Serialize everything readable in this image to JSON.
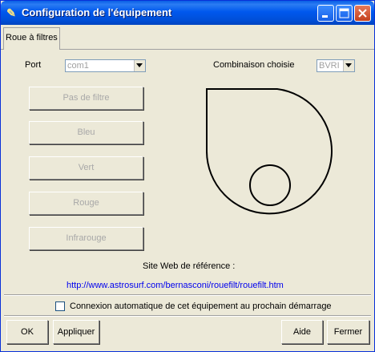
{
  "window": {
    "title": "Configuration de l'équipement"
  },
  "tabs": [
    {
      "label": "Roue à filtres"
    }
  ],
  "port": {
    "label": "Port",
    "value": "com1"
  },
  "combination": {
    "label": "Combinaison choisie",
    "value": "BVRI"
  },
  "filter_buttons": [
    {
      "label": "Pas de filtre"
    },
    {
      "label": "Bleu"
    },
    {
      "label": "Vert"
    },
    {
      "label": "Rouge"
    },
    {
      "label": "Infrarouge"
    }
  ],
  "reference": {
    "label": "Site Web de référence :",
    "url": "http://www.astrosurf.com/bernasconi/rouefilt/rouefilt.htm"
  },
  "autoconnect": {
    "label": "Connexion automatique de cet équipement au prochain démarrage",
    "checked": false
  },
  "buttons": {
    "ok": "OK",
    "apply": "Appliquer",
    "help": "Aide",
    "close": "Fermer"
  },
  "colors": {
    "titlebar": "#0058ee",
    "link": "#0000ee",
    "disabled_text": "#a8a8a8"
  }
}
